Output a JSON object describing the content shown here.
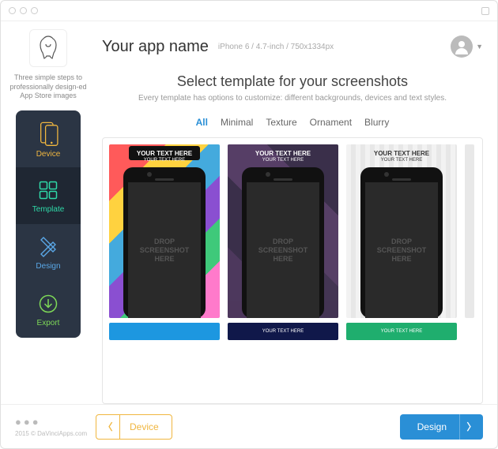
{
  "header": {
    "app_name": "Your app name",
    "device_info": "iPhone 6 / 4.7-inch / 750x1334px"
  },
  "tagline": "Three simple steps to professionally design­-ed App Store images",
  "sidebar": {
    "items": [
      {
        "label": "Device"
      },
      {
        "label": "Template"
      },
      {
        "label": "Design"
      },
      {
        "label": "Export"
      }
    ]
  },
  "content": {
    "title": "Select template for your screenshots",
    "subtitle": "Every template has options to customize: different backgrounds, devices and text styles."
  },
  "tabs": [
    "All",
    "Minimal",
    "Texture",
    "Ornament",
    "Blurry"
  ],
  "template_text": {
    "main": "YOUR TEXT HERE",
    "sub": "YOUR TEXT HERE"
  },
  "placeholder": {
    "l1": "DROP",
    "l2": "SCREENSHOT",
    "l3": "HERE"
  },
  "strip_label": "YOUR TEXT HERE",
  "footer": {
    "prev": "Device",
    "next": "Design",
    "copyright": "2015 © DaVinciApps.com"
  }
}
